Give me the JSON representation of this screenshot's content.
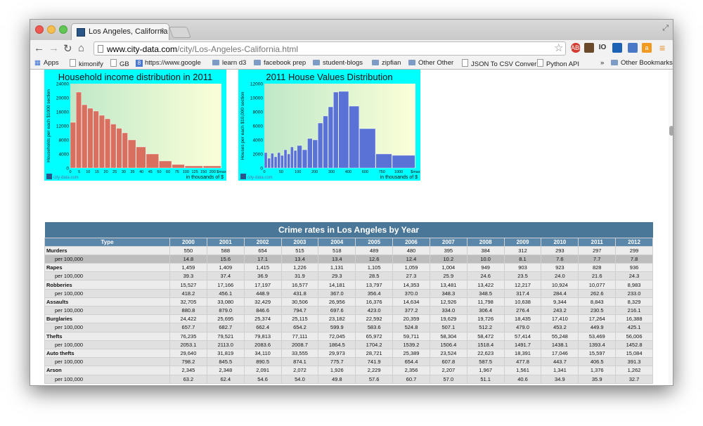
{
  "browser": {
    "tab_title": "Los Angeles, California (CA",
    "tab_close": "×",
    "url_domain": "www.city-data.com",
    "url_path": "/city/Los-Angeles-California.html",
    "resize_glyph": "⤢",
    "nav": {
      "back": "←",
      "forward": "→",
      "reload": "↻",
      "home": "⌂",
      "star": "☆",
      "menu": "≡"
    },
    "extensions": [
      "ABP",
      "",
      "IO",
      "",
      "",
      "a"
    ],
    "bookmarks": [
      "Apps",
      "kimonify",
      "GB",
      "https://www.google",
      "learn d3",
      "facebook prep",
      "student-blogs",
      "zipfian",
      "Other Other",
      "JSON To CSV Conver",
      "Python API"
    ],
    "bookmarks_overflow": "»",
    "other_bookmarks": "Other Bookmarks"
  },
  "colors": {
    "chart_bg": "#00ffff",
    "income_bar": "#d9705f",
    "house_bar": "#5a72d6",
    "table_header": "#5b87ab",
    "table_title": "#4a7798"
  },
  "chart_data": [
    {
      "type": "bar",
      "title": "Household income distribution in 2011",
      "ylabel": "Households per each $1000 section",
      "xlabel": "in thousands of $",
      "ylim": [
        0,
        24000
      ],
      "yticks": [
        "0",
        "4000",
        "8000",
        "12000",
        "16000",
        "20000",
        "24000"
      ],
      "xticks": [
        "0",
        "5",
        "10",
        "15",
        "20",
        "25",
        "30",
        "35",
        "40",
        "45",
        "50",
        "60",
        "75",
        "100",
        "125",
        "150",
        "200",
        "$max"
      ],
      "bins": [
        {
          "x0": 0,
          "x1": 5,
          "value": 13000
        },
        {
          "x0": 5,
          "x1": 10,
          "value": 21600
        },
        {
          "x0": 10,
          "x1": 15,
          "value": 18000
        },
        {
          "x0": 15,
          "x1": 20,
          "value": 17000
        },
        {
          "x0": 20,
          "x1": 25,
          "value": 16200
        },
        {
          "x0": 25,
          "x1": 30,
          "value": 15000
        },
        {
          "x0": 30,
          "x1": 35,
          "value": 14000
        },
        {
          "x0": 35,
          "x1": 40,
          "value": 12500
        },
        {
          "x0": 40,
          "x1": 45,
          "value": 11300
        },
        {
          "x0": 45,
          "x1": 50,
          "value": 10000
        },
        {
          "x0": 50,
          "x1": 60,
          "value": 8000
        },
        {
          "x0": 60,
          "x1": 75,
          "value": 6000
        },
        {
          "x0": 75,
          "x1": 100,
          "value": 4000
        },
        {
          "x0": 100,
          "x1": 125,
          "value": 2000
        },
        {
          "x0": 125,
          "x1": 150,
          "value": 1000
        },
        {
          "x0": 150,
          "x1": 200,
          "value": 600
        },
        {
          "x0": 200,
          "x1": 250,
          "value": 600
        }
      ],
      "watermark": "city-data.com"
    },
    {
      "type": "bar",
      "title": "2011 House Values Distribution",
      "ylabel": "Houses per each $10,000 section",
      "xlabel": "in thousands of $",
      "ylim": [
        0,
        12000
      ],
      "yticks": [
        "0",
        "2000",
        "4000",
        "6000",
        "8000",
        "10000",
        "12000"
      ],
      "xticks": [
        "0",
        "50",
        "100",
        "200",
        "300",
        "400",
        "600",
        "750",
        "1000",
        "$max"
      ],
      "bins": [
        {
          "x0": 0,
          "x1": 10,
          "value": 2200
        },
        {
          "x0": 10,
          "x1": 20,
          "value": 1400
        },
        {
          "x0": 20,
          "x1": 30,
          "value": 2100
        },
        {
          "x0": 30,
          "x1": 40,
          "value": 1600
        },
        {
          "x0": 40,
          "x1": 50,
          "value": 2200
        },
        {
          "x0": 50,
          "x1": 60,
          "value": 1800
        },
        {
          "x0": 60,
          "x1": 70,
          "value": 2600
        },
        {
          "x0": 70,
          "x1": 80,
          "value": 2000
        },
        {
          "x0": 80,
          "x1": 90,
          "value": 3000
        },
        {
          "x0": 90,
          "x1": 100,
          "value": 2500
        },
        {
          "x0": 100,
          "x1": 125,
          "value": 3200
        },
        {
          "x0": 125,
          "x1": 150,
          "value": 2600
        },
        {
          "x0": 150,
          "x1": 175,
          "value": 4200
        },
        {
          "x0": 175,
          "x1": 200,
          "value": 4000
        },
        {
          "x0": 200,
          "x1": 225,
          "value": 6400
        },
        {
          "x0": 225,
          "x1": 250,
          "value": 7400
        },
        {
          "x0": 250,
          "x1": 275,
          "value": 8700
        },
        {
          "x0": 275,
          "x1": 300,
          "value": 10800
        },
        {
          "x0": 300,
          "x1": 400,
          "value": 10900
        },
        {
          "x0": 400,
          "x1": 500,
          "value": 8800
        },
        {
          "x0": 500,
          "x1": 750,
          "value": 5600
        },
        {
          "x0": 750,
          "x1": 1000,
          "value": 2000
        },
        {
          "x0": 1000,
          "x1": 1500,
          "value": 1800
        }
      ],
      "watermark": "city-data.com"
    }
  ],
  "crime_table": {
    "title": "Crime rates in Los Angeles by Year",
    "columns": [
      "Type",
      "2000",
      "2001",
      "2002",
      "2003",
      "2004",
      "2005",
      "2006",
      "2007",
      "2008",
      "2009",
      "2010",
      "2011",
      "2012"
    ],
    "rows": [
      {
        "label": "Murders",
        "kind": "cat",
        "values": [
          "550",
          "588",
          "654",
          "515",
          "518",
          "489",
          "480",
          "395",
          "384",
          "312",
          "293",
          "297",
          "299"
        ]
      },
      {
        "label": "per 100,000",
        "kind": "sub-hl",
        "values": [
          "14.8",
          "15.6",
          "17.1",
          "13.4",
          "13.4",
          "12.6",
          "12.4",
          "10.2",
          "10.0",
          "8.1",
          "7.6",
          "7.7",
          "7.8"
        ]
      },
      {
        "label": "Rapes",
        "kind": "cat",
        "values": [
          "1,459",
          "1,409",
          "1,415",
          "1,226",
          "1,131",
          "1,105",
          "1,059",
          "1,004",
          "949",
          "903",
          "923",
          "828",
          "936"
        ]
      },
      {
        "label": "per 100,000",
        "kind": "sub",
        "values": [
          "39.3",
          "37.4",
          "36.9",
          "31.9",
          "29.3",
          "28.5",
          "27.3",
          "25.9",
          "24.6",
          "23.5",
          "24.0",
          "21.6",
          "24.3"
        ]
      },
      {
        "label": "Robberies",
        "kind": "cat",
        "values": [
          "15,527",
          "17,166",
          "17,197",
          "16,577",
          "14,181",
          "13,797",
          "14,353",
          "13,481",
          "13,422",
          "12,217",
          "10,924",
          "10,077",
          "8,983"
        ]
      },
      {
        "label": "per 100,000",
        "kind": "sub",
        "values": [
          "418.2",
          "456.1",
          "448.9",
          "431.8",
          "367.0",
          "356.4",
          "370.0",
          "348.3",
          "348.5",
          "317.4",
          "284.4",
          "262.6",
          "233.0"
        ]
      },
      {
        "label": "Assaults",
        "kind": "cat",
        "values": [
          "32,705",
          "33,080",
          "32,429",
          "30,506",
          "26,956",
          "16,376",
          "14,634",
          "12,926",
          "11,798",
          "10,638",
          "9,344",
          "8,843",
          "8,329"
        ]
      },
      {
        "label": "per 100,000",
        "kind": "sub",
        "values": [
          "880.8",
          "879.0",
          "846.6",
          "794.7",
          "697.6",
          "423.0",
          "377.2",
          "334.0",
          "306.4",
          "276.4",
          "243.2",
          "230.5",
          "216.1"
        ]
      },
      {
        "label": "Burglaries",
        "kind": "cat",
        "values": [
          "24,422",
          "25,695",
          "25,374",
          "25,115",
          "23,182",
          "22,592",
          "20,359",
          "19,629",
          "19,726",
          "18,435",
          "17,410",
          "17,264",
          "16,388"
        ]
      },
      {
        "label": "per 100,000",
        "kind": "sub",
        "values": [
          "657.7",
          "682.7",
          "662.4",
          "654.2",
          "599.9",
          "583.6",
          "524.8",
          "507.1",
          "512.2",
          "479.0",
          "453.2",
          "449.9",
          "425.1"
        ]
      },
      {
        "label": "Thefts",
        "kind": "cat",
        "values": [
          "76,235",
          "79,521",
          "79,813",
          "77,111",
          "72,045",
          "65,972",
          "59,711",
          "58,304",
          "58,472",
          "57,414",
          "55,248",
          "53,469",
          "56,006"
        ]
      },
      {
        "label": "per 100,000",
        "kind": "sub",
        "values": [
          "2053.1",
          "2113.0",
          "2083.6",
          "2008.7",
          "1864.5",
          "1704.2",
          "1539.2",
          "1506.4",
          "1518.4",
          "1491.7",
          "1438.1",
          "1393.4",
          "1452.8"
        ]
      },
      {
        "label": "Auto thefts",
        "kind": "cat",
        "values": [
          "29,640",
          "31,819",
          "34,110",
          "33,555",
          "29,973",
          "28,721",
          "25,389",
          "23,524",
          "22,623",
          "18,391",
          "17,046",
          "15,597",
          "15,084"
        ]
      },
      {
        "label": "per 100,000",
        "kind": "sub",
        "values": [
          "798.2",
          "845.5",
          "890.5",
          "874.1",
          "775.7",
          "741.9",
          "654.4",
          "607.8",
          "587.5",
          "477.8",
          "443.7",
          "406.5",
          "391.3"
        ]
      },
      {
        "label": "Arson",
        "kind": "cat",
        "values": [
          "2,345",
          "2,348",
          "2,091",
          "2,072",
          "1,926",
          "2,229",
          "2,356",
          "2,207",
          "1,967",
          "1,561",
          "1,341",
          "1,376",
          "1,262"
        ]
      },
      {
        "label": "per 100,000",
        "kind": "sub",
        "values": [
          "63.2",
          "62.4",
          "54.6",
          "54.0",
          "49.8",
          "57.6",
          "60.7",
          "57.0",
          "51.1",
          "40.6",
          "34.9",
          "35.9",
          "32.7"
        ]
      }
    ]
  }
}
